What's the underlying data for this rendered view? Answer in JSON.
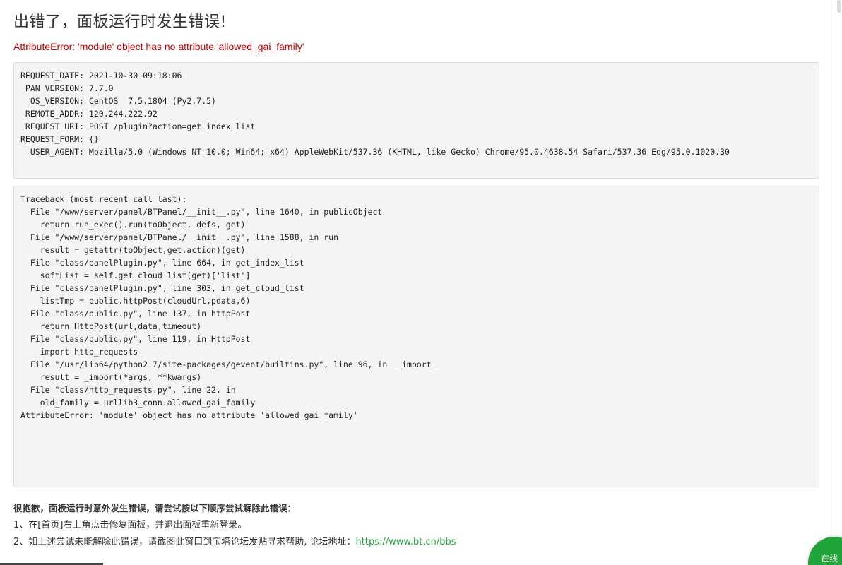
{
  "title": "出错了，面板运行时发生错误!",
  "error_message": "AttributeError: 'module' object has no attribute 'allowed_gai_family'",
  "request_info": [
    "REQUEST_DATE: 2021-10-30 09:18:06",
    " PAN_VERSION: 7.7.0",
    "  OS_VERSION: CentOS  7.5.1804 (Py2.7.5)",
    " REMOTE_ADDR: 120.244.222.92",
    " REQUEST_URI: POST /plugin?action=get_index_list",
    "REQUEST_FORM: {}",
    "  USER_AGENT: Mozilla/5.0 (Windows NT 10.0; Win64; x64) AppleWebKit/537.36 (KHTML, like Gecko) Chrome/95.0.4638.54 Safari/537.36 Edg/95.0.1020.30"
  ],
  "traceback": [
    "Traceback (most recent call last):",
    "  File \"/www/server/panel/BTPanel/__init__.py\", line 1640, in publicObject",
    "    return run_exec().run(toObject, defs, get)",
    "  File \"/www/server/panel/BTPanel/__init__.py\", line 1588, in run",
    "    result = getattr(toObject,get.action)(get)",
    "  File \"class/panelPlugin.py\", line 664, in get_index_list",
    "    softList = self.get_cloud_list(get)['list']",
    "  File \"class/panelPlugin.py\", line 303, in get_cloud_list",
    "    listTmp = public.httpPost(cloudUrl,pdata,6)",
    "  File \"class/public.py\", line 137, in httpPost",
    "    return HttpPost(url,data,timeout)",
    "  File \"class/public.py\", line 119, in HttpPost",
    "    import http_requests",
    "  File \"/usr/lib64/python2.7/site-packages/gevent/builtins.py\", line 96, in __import__",
    "    result = _import(*args, **kwargs)",
    "  File \"class/http_requests.py\", line 22, in",
    "    old_family = urllib3_conn.allowed_gai_family",
    "AttributeError: 'module' object has no attribute 'allowed_gai_family'"
  ],
  "help": {
    "heading": "很抱歉，面板运行时意外发生错误，请尝试按以下顺序尝试解除此错误：",
    "step1": "1、在[首页]右上角点击修复面板，并退出面板重新登录。",
    "step2_prefix": "2、如上述尝试未能解除此错误，请截图此窗口到宝塔论坛发贴寻求帮助, 论坛地址：",
    "step2_link": "https://www.bt.cn/bbs"
  },
  "online_badge": {
    "label": "在线"
  },
  "colors": {
    "error": "#cc0000",
    "link": "#20a53a",
    "badge": "#20a53a",
    "box_bg": "#f4f4f4"
  }
}
